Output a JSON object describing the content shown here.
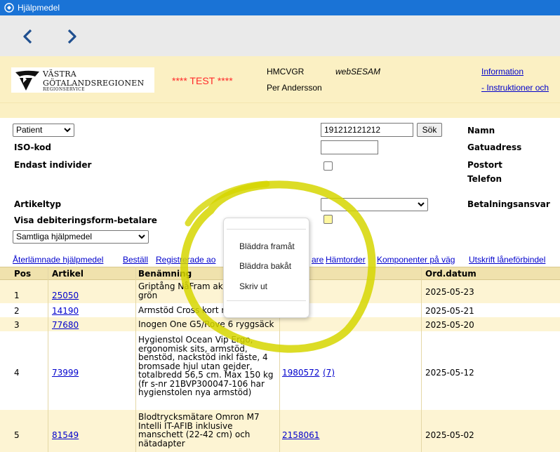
{
  "window": {
    "title": "Hjälpmedel"
  },
  "header": {
    "logo_line1": "VÄSTRA",
    "logo_line2": "GÖTALANDSREGIONEN",
    "logo_line3": "REGIONSERVICE",
    "test_banner": "**** TEST ****",
    "org_code": "HMCVGR",
    "system_name": "webSESAM",
    "user_name": "Per Andersson",
    "info_link": "Information",
    "instructions_link": "- Instruktioner och"
  },
  "form": {
    "search_type": "Patient",
    "iso_label": "ISO-kod",
    "individ_label": "Endast individer",
    "artikeltyp_label": "Artikeltyp",
    "debitering_label": "Visa debiteringsform-betalare",
    "filter_select": "Samtliga hjälpmedel",
    "search_value": "191212121212",
    "search_button": "Sök",
    "iso_value": "",
    "artikeltyp_value": "",
    "patient_fields": {
      "namn": "Namn",
      "gatuadress": "Gatuadress",
      "postort": "Postort",
      "telefon": "Telefon",
      "betalningsansvar": "Betalningsansvar"
    }
  },
  "links": [
    "Återlämnade hjälpmedel",
    "Beställ",
    "Registrerade ao",
    "are",
    "Hämtorder",
    "Komponenter på väg",
    "Utskrift låneförbindel"
  ],
  "table": {
    "headers": {
      "pos": "Pos",
      "artikel": "Artikel",
      "benamning": "Benämning",
      "id": "id",
      "orddatum": "Ord.datum"
    },
    "rows": [
      {
        "pos": "1",
        "artikel": "25050",
        "lines": [
          "Griptång NåFram ak",
          "grön"
        ],
        "id": "",
        "date": "2025-05-23"
      },
      {
        "pos": "2",
        "artikel": "14190",
        "lines": [
          "Armstöd Cross kort rö"
        ],
        "id": "",
        "date": "2025-05-21"
      },
      {
        "pos": "3",
        "artikel": "77680",
        "lines": [
          "Inogen One G5/Rove 6 ryggsäck"
        ],
        "id": "",
        "date": "2025-05-20"
      },
      {
        "pos": "4",
        "artikel": "73999",
        "lines": [
          "Hygienstol Ocean Vip Ergo,",
          "ergonomisk sits, armstöd,",
          "benstöd, nackstöd inkl fäste, 4",
          "bromsade hjul utan gejder,",
          "totalbredd 56,5 cm. Max 150 kg",
          "(fr s-nr 21BVP300047-106 har",
          "hygienstolen nya armstöd)"
        ],
        "id": "1980572",
        "id_extra": "(7)",
        "date": "2025-05-12"
      },
      {
        "pos": "5",
        "artikel": "81549",
        "lines": [
          "Blodtrycksmätare Omron M7",
          "Intelli IT-AFIB inklusive",
          "manschett (22-42 cm) och",
          "nätadapter"
        ],
        "id": "2158061",
        "date": "2025-05-02"
      }
    ]
  },
  "context_menu": {
    "items": [
      "Bläddra framåt",
      "Bläddra bakåt",
      "Skriv ut"
    ]
  },
  "colors": {
    "titlebar": "#1a73d6",
    "header_bg": "#fbf0c3",
    "table_header_bg": "#f0e2ad",
    "link": "#0000cc",
    "test_red": "#ff2a2a",
    "highlight": "#d6d600"
  },
  "icons": {
    "title": "app-icon",
    "back": "chevron-left-icon",
    "forward": "chevron-right-icon",
    "dropdown": "chevron-down-icon"
  }
}
